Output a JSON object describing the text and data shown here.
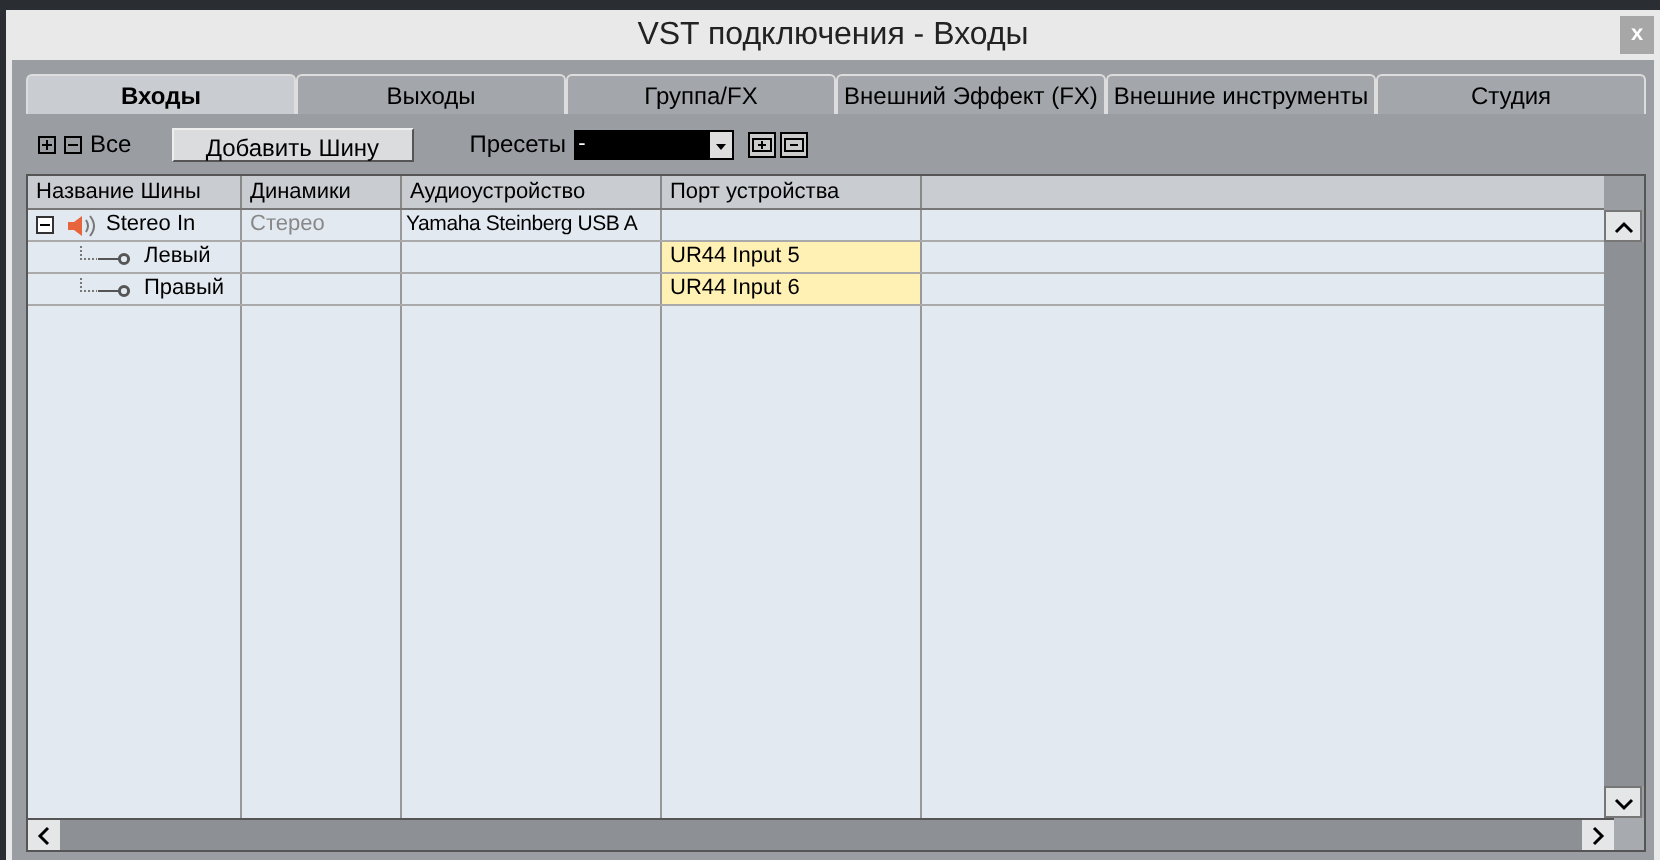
{
  "window": {
    "title": "VST подключения - Входы",
    "close": "x"
  },
  "tabs": [
    {
      "label": "Входы",
      "selected": true
    },
    {
      "label": "Выходы",
      "selected": false
    },
    {
      "label": "Группа/FX",
      "selected": false
    },
    {
      "label": "Внешний Эффект (FX)",
      "selected": false
    },
    {
      "label": "Внешние инструменты",
      "selected": false
    },
    {
      "label": "Студия",
      "selected": false
    }
  ],
  "toolbar": {
    "all_label": "Все",
    "add_bus": "Добавить Шину",
    "presets_label": "Пресеты",
    "preset_value": "-"
  },
  "table": {
    "columns": [
      "Название Шины",
      "Динамики",
      "Аудиоустройство",
      "Порт устройства"
    ],
    "rows": [
      {
        "name": "Stereo In",
        "expanded": true,
        "speakers": "Стерео",
        "device": "Yamaha Steinberg USB A",
        "children": [
          {
            "name": "Левый",
            "port": "UR44 Input 5"
          },
          {
            "name": "Правый",
            "port": "UR44 Input 6"
          }
        ]
      }
    ]
  }
}
